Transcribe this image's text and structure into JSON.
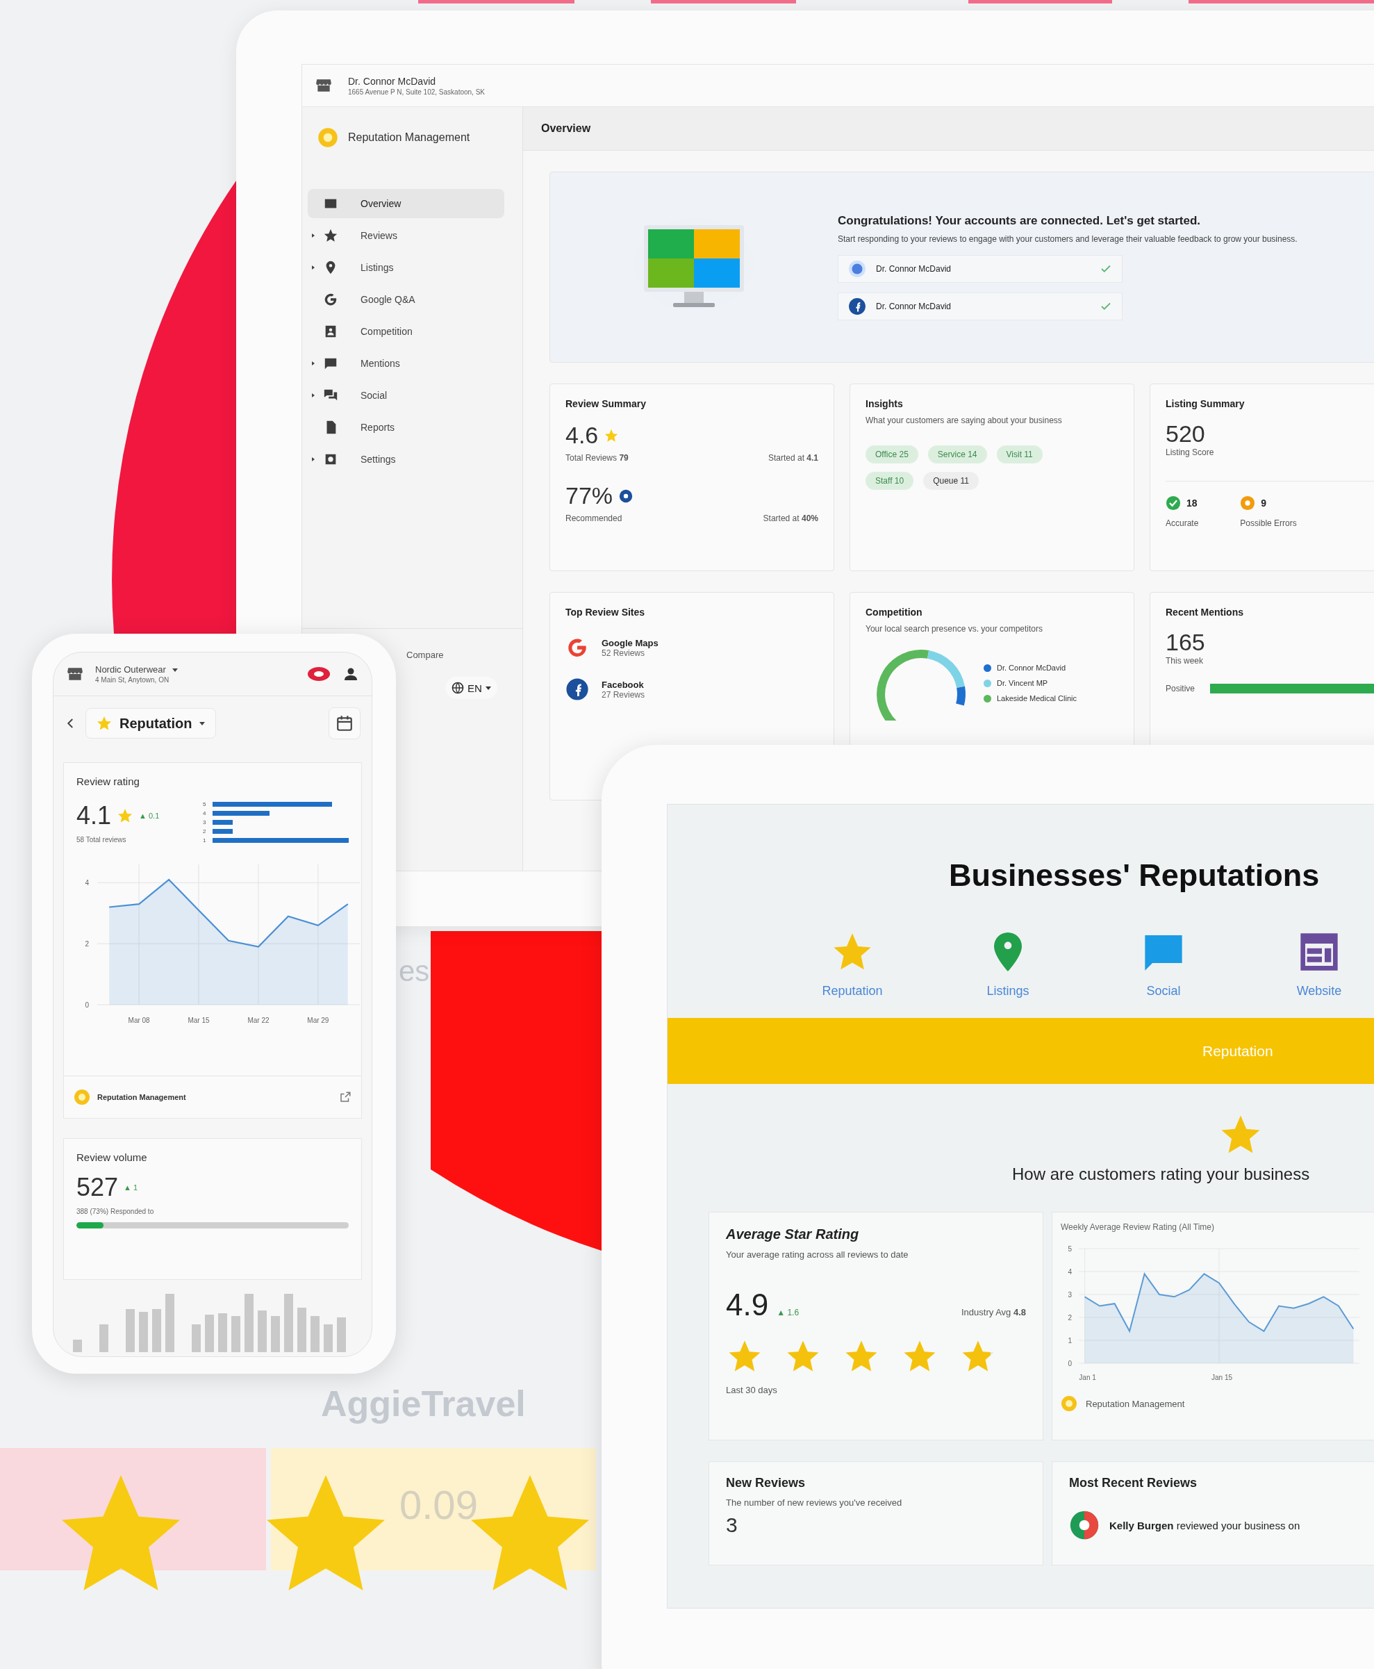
{
  "backdrop": {
    "fragment": "es",
    "brand": "AggieTravel",
    "value": "0.09"
  },
  "desktop": {
    "account": {
      "name": "Dr. Connor McDavid",
      "address": "1665 Avenue P N, Suite 102, Saskatoon, SK"
    },
    "app_title": "Reputation Management",
    "nav": [
      {
        "label": "Overview",
        "selected": true,
        "expandable": false
      },
      {
        "label": "Reviews",
        "selected": false,
        "expandable": true
      },
      {
        "label": "Listings",
        "selected": false,
        "expandable": true
      },
      {
        "label": "Google Q&A",
        "selected": false,
        "expandable": false
      },
      {
        "label": "Competition",
        "selected": false,
        "expandable": false
      },
      {
        "label": "Mentions",
        "selected": false,
        "expandable": true
      },
      {
        "label": "Social",
        "selected": false,
        "expandable": true
      },
      {
        "label": "Reports",
        "selected": false,
        "expandable": false
      },
      {
        "label": "Settings",
        "selected": false,
        "expandable": true
      }
    ],
    "footer": {
      "compare": "Compare",
      "language": "EN"
    },
    "page_title": "Overview",
    "welcome": {
      "title": "Congratulations! Your accounts are connected. Let's get started.",
      "text": "Start responding to your reviews to engage with your customers and leverage their valuable feedback to grow your business.",
      "accounts": [
        {
          "kind": "google",
          "name": "Dr. Connor McDavid",
          "connected": true
        },
        {
          "kind": "facebook",
          "name": "Dr. Connor McDavid",
          "connected": true
        }
      ]
    },
    "review_summary": {
      "title": "Review Summary",
      "rating": "4.6",
      "total_label": "Total Reviews",
      "total": "79",
      "rating_start_label": "Started at",
      "rating_start": "4.1",
      "recommended": "77%",
      "recommended_label": "Recommended",
      "recommended_start_label": "Started at",
      "recommended_start": "40%"
    },
    "insights": {
      "title": "Insights",
      "subtitle": "What your customers are saying about your business",
      "chips": [
        {
          "label": "Office 25",
          "kind": "positive"
        },
        {
          "label": "Service 14",
          "kind": "positive"
        },
        {
          "label": "Visit 11",
          "kind": "positive"
        },
        {
          "label": "Staff 10",
          "kind": "positive"
        },
        {
          "label": "Queue 11",
          "kind": "neutral"
        }
      ]
    },
    "listing_summary": {
      "title": "Listing Summary",
      "score": "520",
      "score_label": "Listing Score",
      "stats": [
        {
          "kind": "ok",
          "count": "18",
          "label": "Accurate"
        },
        {
          "kind": "warning",
          "count": "9",
          "label": "Possible Errors"
        }
      ]
    },
    "top_sites": {
      "title": "Top Review Sites",
      "sites": [
        {
          "kind": "google",
          "name": "Google Maps",
          "count": "52 Reviews"
        },
        {
          "kind": "facebook",
          "name": "Facebook",
          "count": "27 Reviews"
        }
      ]
    },
    "competition": {
      "title": "Competition",
      "subtitle": "Your local search presence vs. your competitors",
      "legend": [
        {
          "name": "Dr. Connor McDavid",
          "color": "#1e6fd0"
        },
        {
          "name": "Dr. Vincent MP",
          "color": "#7fd3e6"
        },
        {
          "name": "Lakeside Medical Clinic",
          "color": "#5cb85c"
        }
      ]
    },
    "mentions": {
      "title": "Recent Mentions",
      "count": "165",
      "period": "This week",
      "bar_label": "Positive"
    }
  },
  "phone": {
    "business": "Nordic Outerwear",
    "address": "4 Main St, Anytown, ON",
    "section": "Reputation",
    "rating": {
      "title": "Review rating",
      "value": "4.1",
      "delta": "▲ 0.1",
      "total": "58 Total reviews",
      "distribution": [
        {
          "label": "5"
        },
        {
          "label": "4"
        },
        {
          "label": "3"
        },
        {
          "label": "2"
        },
        {
          "label": "1"
        }
      ],
      "chart_data": {
        "type": "area",
        "grid": true,
        "categories": [
          null,
          "Mar 08",
          null,
          "Mar 15",
          null,
          "Mar 22",
          null,
          "Mar 29",
          null
        ],
        "ylim": [
          0,
          4.6
        ],
        "series": [
          {
            "color": "#4a8fd6",
            "values": [
              3.2,
              3.3,
              4.1,
              3.1,
              2.1,
              1.9,
              2.9,
              2.6,
              3.3
            ]
          }
        ],
        "yticks": [
          0,
          2,
          4
        ]
      }
    },
    "product": "Reputation Management",
    "volume": {
      "title": "Review volume",
      "value": "527",
      "delta": "▲ 1",
      "responded": "388 (73%) Responded to",
      "level": 0.1
    }
  },
  "tablet": {
    "title": "Businesses' Reputations",
    "tabs": [
      {
        "label": "Reputation"
      },
      {
        "label": "Listings"
      },
      {
        "label": "Social"
      },
      {
        "label": "Website"
      }
    ],
    "banner": "Reputation",
    "question": "How are customers rating your business",
    "rating": {
      "title": "Average Star Rating",
      "subtitle": "Your average rating across all reviews to date",
      "value": "4.9",
      "delta": "▲ 1.6",
      "industry_label": "Industry Avg",
      "industry": "4.8",
      "stars": 4.9,
      "period": "Last 30 days"
    },
    "weekly": {
      "chart_data": {
        "type": "area",
        "grid": true,
        "title": "Weekly Average Review Rating (All Time)",
        "categories": [
          "Jan 1",
          null,
          null,
          null,
          null,
          null,
          null,
          null,
          null,
          "Jan 15",
          null,
          null,
          null,
          null,
          null,
          null,
          null,
          null,
          null
        ],
        "ylim": [
          0,
          5
        ],
        "series": [
          {
            "color": "#5b9bd5",
            "values": [
              2.9,
              2.5,
              2.6,
              1.4,
              3.9,
              3.0,
              2.9,
              3.2,
              3.9,
              3.5,
              2.6,
              1.8,
              1.4,
              2.5,
              2.4,
              2.6,
              2.9,
              2.5,
              1.5
            ]
          }
        ],
        "yticks": [
          0,
          1,
          2,
          3,
          4,
          5
        ]
      },
      "product": "Reputation Management"
    },
    "new_reviews": {
      "title": "New Reviews",
      "subtitle": "The number of new reviews you've received",
      "value": "3"
    },
    "recent": {
      "title": "Most Recent Reviews",
      "text": "**Kelly Burgen** reviewed your business on"
    }
  }
}
